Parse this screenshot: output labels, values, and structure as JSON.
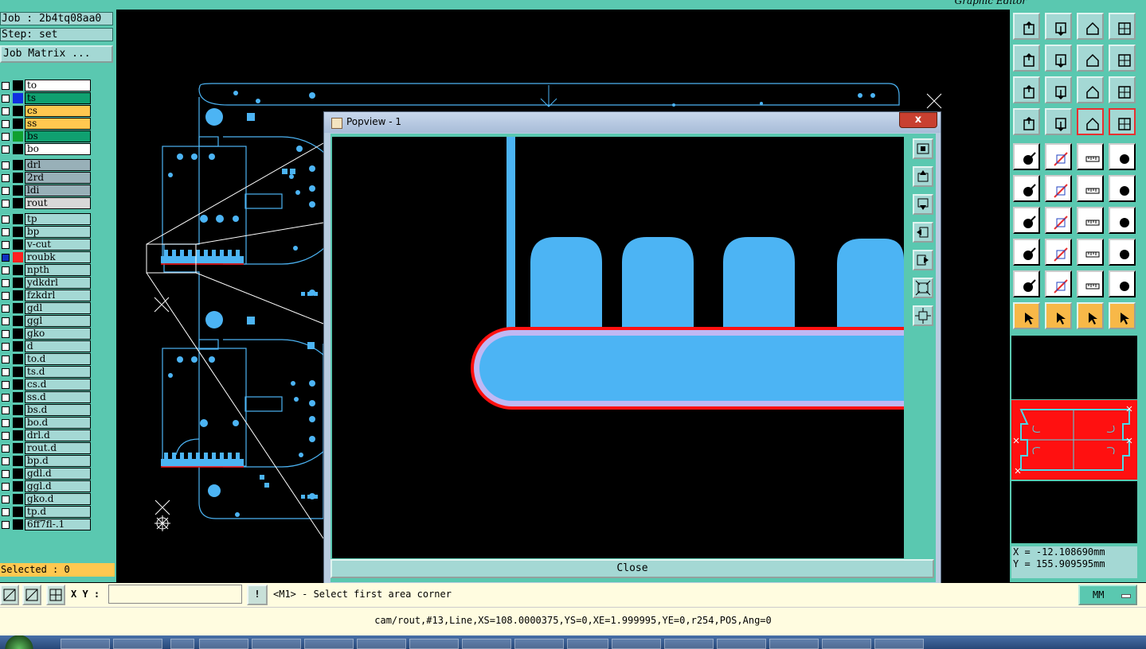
{
  "window_title": "Graphic Editor",
  "job_label": "Job : 2b4tq08aa0",
  "step_label": "Step: set",
  "job_matrix_button": "Job Matrix ...",
  "layers": [
    {
      "name": "to",
      "swatch": "#000000",
      "bg": "#ffffff"
    },
    {
      "name": "ts",
      "swatch": "#1030e0",
      "bg": "#10a070"
    },
    {
      "name": "cs",
      "swatch": "#000000",
      "bg": "#ffc850"
    },
    {
      "name": "ss",
      "swatch": "#000000",
      "bg": "#ffc850"
    },
    {
      "name": "bs",
      "swatch": "#10a030",
      "bg": "#10a070"
    },
    {
      "name": "bo",
      "swatch": "#000000",
      "bg": "#ffffff"
    },
    {
      "name": "drl",
      "swatch": "#000000",
      "bg": "#98b0b8"
    },
    {
      "name": "2rd",
      "swatch": "#000000",
      "bg": "#98b0b8"
    },
    {
      "name": "ldi",
      "swatch": "#000000",
      "bg": "#98b0b8"
    },
    {
      "name": "rout",
      "swatch": "#000000",
      "bg": "#d8d8d8"
    },
    {
      "name": "tp",
      "swatch": "#000000",
      "bg": "#a4d8d4"
    },
    {
      "name": "bp",
      "swatch": "#000000",
      "bg": "#a4d8d4"
    },
    {
      "name": "v-cut",
      "swatch": "#000000",
      "bg": "#a4d8d4"
    },
    {
      "name": "roubk",
      "swatch": "#ff2020",
      "bg": "#a4d8d4",
      "active": true
    },
    {
      "name": "npth",
      "swatch": "#000000",
      "bg": "#a4d8d4"
    },
    {
      "name": "ydkdrl",
      "swatch": "#000000",
      "bg": "#a4d8d4"
    },
    {
      "name": "fzkdrl",
      "swatch": "#000000",
      "bg": "#a4d8d4"
    },
    {
      "name": "gdl",
      "swatch": "#000000",
      "bg": "#a4d8d4"
    },
    {
      "name": "ggl",
      "swatch": "#000000",
      "bg": "#a4d8d4"
    },
    {
      "name": "gko",
      "swatch": "#000000",
      "bg": "#a4d8d4"
    },
    {
      "name": "d",
      "swatch": "#000000",
      "bg": "#a4d8d4"
    },
    {
      "name": "to.d",
      "swatch": "#000000",
      "bg": "#a4d8d4"
    },
    {
      "name": "ts.d",
      "swatch": "#000000",
      "bg": "#a4d8d4"
    },
    {
      "name": "cs.d",
      "swatch": "#000000",
      "bg": "#a4d8d4"
    },
    {
      "name": "ss.d",
      "swatch": "#000000",
      "bg": "#a4d8d4"
    },
    {
      "name": "bs.d",
      "swatch": "#000000",
      "bg": "#a4d8d4"
    },
    {
      "name": "bo.d",
      "swatch": "#000000",
      "bg": "#a4d8d4"
    },
    {
      "name": "drl.d",
      "swatch": "#000000",
      "bg": "#a4d8d4"
    },
    {
      "name": "rout.d",
      "swatch": "#000000",
      "bg": "#a4d8d4"
    },
    {
      "name": "bp.d",
      "swatch": "#000000",
      "bg": "#a4d8d4"
    },
    {
      "name": "gdl.d",
      "swatch": "#000000",
      "bg": "#a4d8d4"
    },
    {
      "name": "ggl.d",
      "swatch": "#000000",
      "bg": "#a4d8d4"
    },
    {
      "name": "gko.d",
      "swatch": "#000000",
      "bg": "#a4d8d4"
    },
    {
      "name": "tp.d",
      "swatch": "#000000",
      "bg": "#a4d8d4"
    },
    {
      "name": "6ff7fl-.1",
      "swatch": "#000000",
      "bg": "#a4d8d4"
    }
  ],
  "selected_label": "Selected : 0",
  "popup": {
    "title": "Popview - 1",
    "close_x": "x",
    "close_button": "Close"
  },
  "coords": {
    "x": "X = -12.108690mm",
    "y": "Y = 155.909595mm"
  },
  "xy_label": "X Y :",
  "xy_value": "",
  "bang_label": "!",
  "prompt": "<M1> - Select first area corner",
  "units": "MM",
  "status": "cam/rout,#13,Line,XS=108.0000375,YS=0,XE=1.999995,YE=0,r254,POS,Ang=0",
  "colors": {
    "panel": "#5ac8b0",
    "feature": "#4cb4f4",
    "outline": "#ff1010",
    "highlight": "#c0b8f4"
  }
}
